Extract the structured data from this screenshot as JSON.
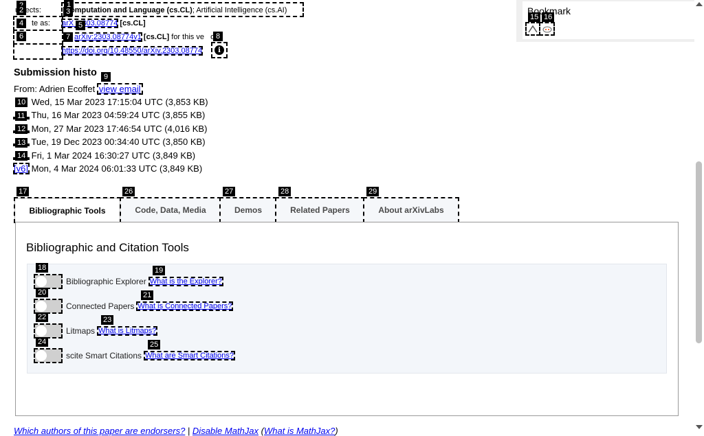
{
  "meta": {
    "subjects_label": "ubjects:",
    "subjects_primary": "omputation and Language (cs.CL)",
    "subjects_secondary": "; Artificial Intelligence (cs.AI)",
    "cite_label": "te as:",
    "cite_id_a": "arX",
    "cite_id_b": "303.08774",
    "cite_cat": "[cs.CL]",
    "version_id": "arXiv:2303.08774v1",
    "version_cat": "[cs.CL]",
    "version_suffix_a": " for this ve",
    "version_suffix_b": "on)",
    "doi": "https://doi.org/10.48550/arXiv.2303.08774",
    "info_glyph": "i"
  },
  "bookmark": {
    "title": "Bookmark"
  },
  "submission": {
    "title": "Submission histo",
    "from_label": "From: Adrien Ecoffet",
    "view_email": "view email",
    "versions": [
      {
        "label": "",
        "text": " Wed, 15 Mar 2023 17:15:04 UTC (3,853 KB)"
      },
      {
        "label": "",
        "text": "Thu, 16 Mar 2023 04:59:24 UTC (3,855 KB)"
      },
      {
        "label": "",
        "text": "Mon, 27 Mar 2023 17:46:54 UTC (4,016 KB)"
      },
      {
        "label": "",
        "text": "Tue, 19 Dec 2023 00:34:40 UTC (3,850 KB)"
      },
      {
        "label": "",
        "text": "Fri, 1 Mar 2024 16:30:27 UTC (3,849 KB)"
      },
      {
        "label": "[v6]",
        "text": " Mon, 4 Mar 2024 06:01:33 UTC (3,849 KB)"
      }
    ]
  },
  "tabs": [
    {
      "label": "Bibliographic Tools"
    },
    {
      "label": "Code, Data, Media"
    },
    {
      "label": "Demos"
    },
    {
      "label": "Related Papers"
    },
    {
      "label": "About arXivLabs"
    }
  ],
  "panel": {
    "title": "Bibliographic and Citation Tools",
    "tools": [
      {
        "label": "Bibliographic Explorer",
        "help": "What is the Explorer?"
      },
      {
        "label": "Connected Papers",
        "help": "What is Connected Papers?"
      },
      {
        "label": "Litmaps",
        "help": "What is Litmaps?"
      },
      {
        "label": "scite Smart Citations",
        "help": "What are Smart Citations?"
      }
    ]
  },
  "footer": {
    "endorsers": "Which authors of this paper are endorsers?",
    "sep": " | ",
    "mathjax": "Disable MathJax",
    "paren_open": " (",
    "what_mathjax": "What is MathJax?",
    "paren_close": ")"
  },
  "badges": [
    "1",
    "2",
    "2",
    "3",
    "4",
    "5",
    "6",
    "7",
    "8",
    "9",
    "10",
    "11",
    "12",
    "13",
    "14",
    "15",
    "16",
    "17",
    "18",
    "19",
    "20",
    "21",
    "22",
    "23",
    "24",
    "25",
    "26",
    "27",
    "28",
    "29"
  ]
}
